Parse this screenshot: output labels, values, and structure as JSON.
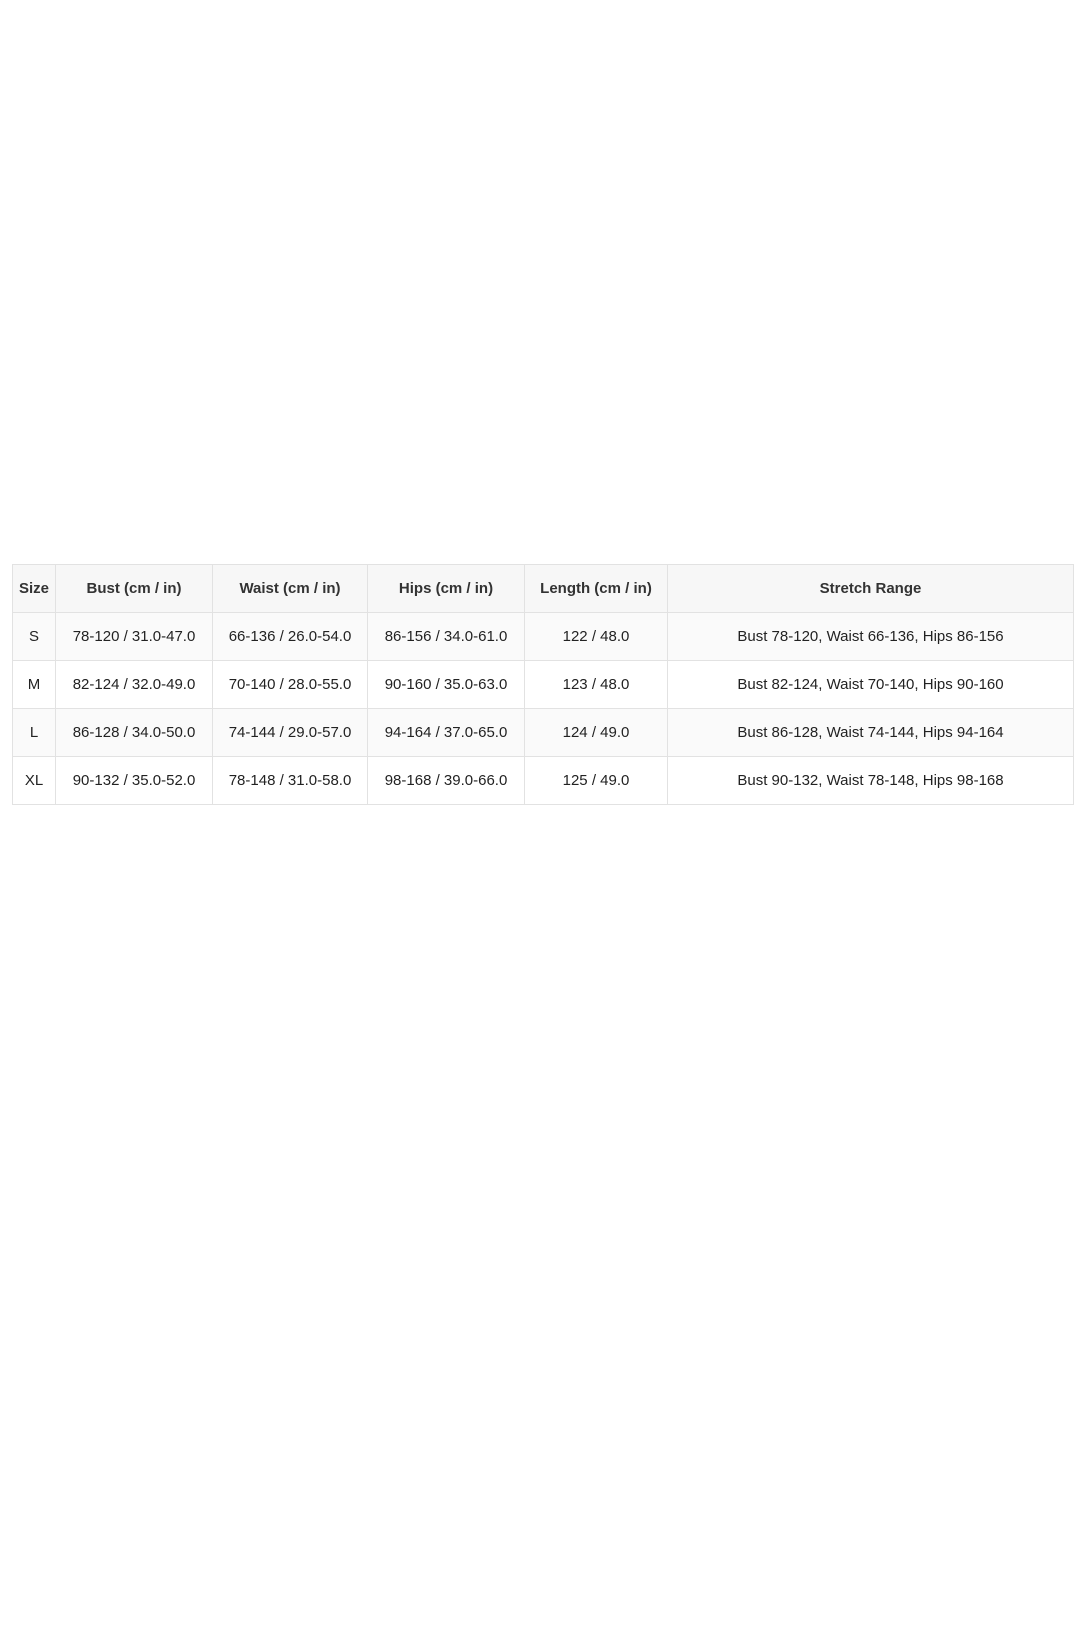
{
  "table": {
    "headers": [
      "Size",
      "Bust (cm / in)",
      "Waist (cm / in)",
      "Hips (cm / in)",
      "Length (cm / in)",
      "Stretch Range"
    ],
    "rows": [
      [
        "S",
        "78-120 / 31.0-47.0",
        "66-136 / 26.0-54.0",
        "86-156 / 34.0-61.0",
        "122 / 48.0",
        "Bust 78-120, Waist 66-136, Hips 86-156"
      ],
      [
        "M",
        "82-124 / 32.0-49.0",
        "70-140 / 28.0-55.0",
        "90-160 / 35.0-63.0",
        "123 / 48.0",
        "Bust 82-124, Waist 70-140, Hips 90-160"
      ],
      [
        "L",
        "86-128 / 34.0-50.0",
        "74-144 / 29.0-57.0",
        "94-164 / 37.0-65.0",
        "124 / 49.0",
        "Bust 86-128, Waist 74-144, Hips 94-164"
      ],
      [
        "XL",
        "90-132 / 35.0-52.0",
        "78-148 / 31.0-58.0",
        "98-168 / 39.0-66.0",
        "125 / 49.0",
        "Bust 90-132, Waist 78-148, Hips 98-168"
      ]
    ]
  },
  "colors": {
    "header_background": "#f7f7f7",
    "border": "#e2e2e2",
    "text": "#222222"
  }
}
